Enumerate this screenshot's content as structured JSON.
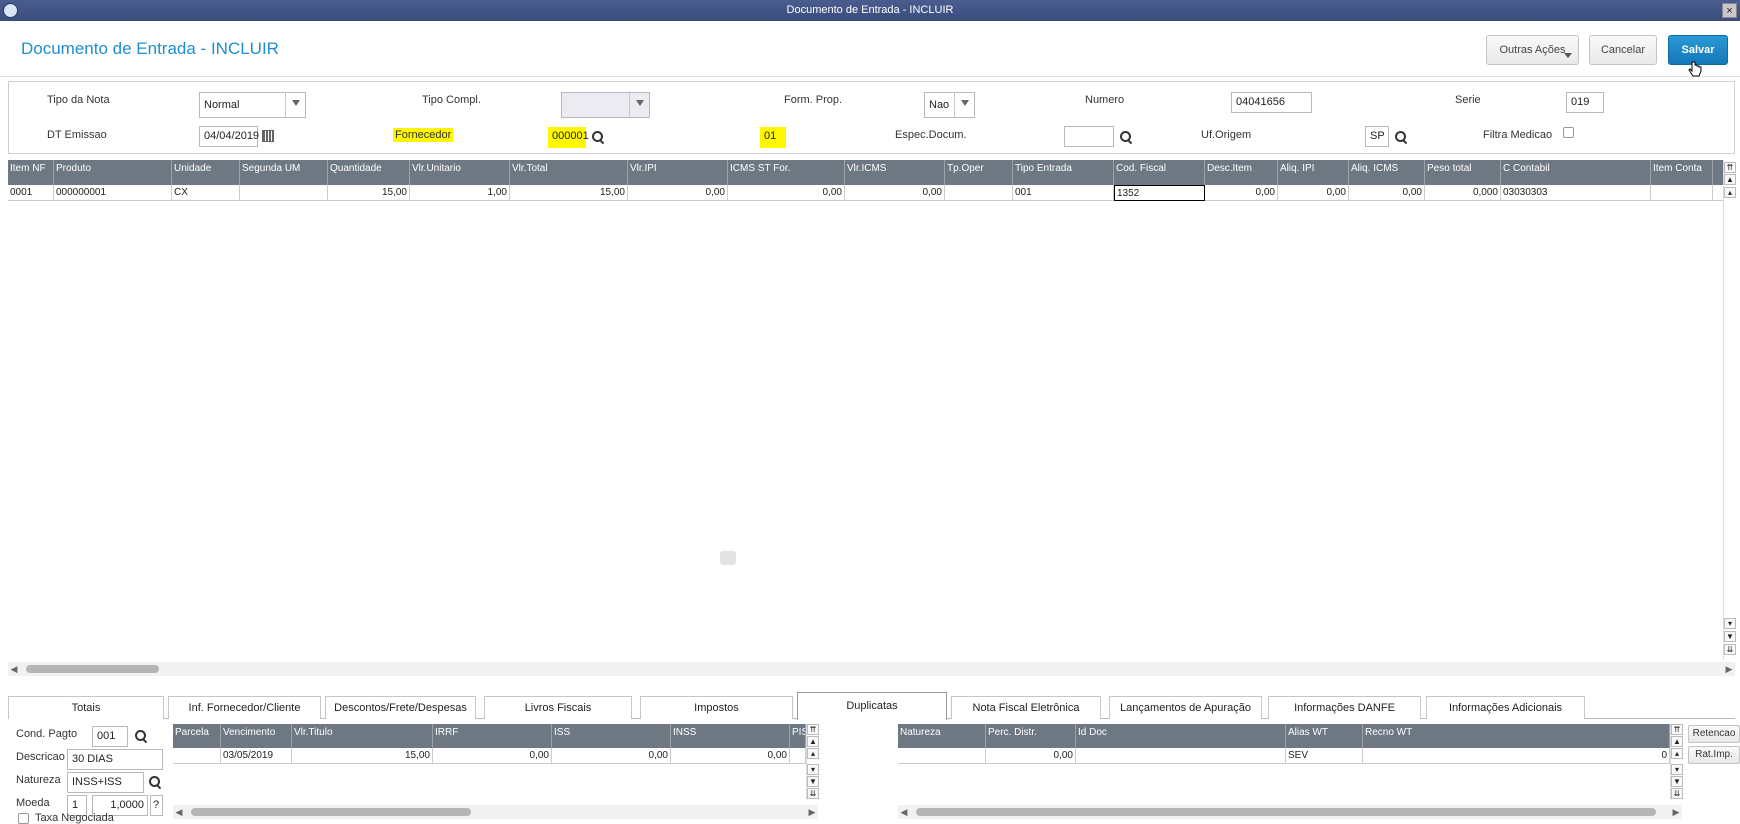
{
  "window": {
    "title": "Documento de Entrada - INCLUIR"
  },
  "header": {
    "title": "Documento de Entrada - INCLUIR",
    "other_actions": "Outras Ações",
    "cancel": "Cancelar",
    "save": "Salvar"
  },
  "form": {
    "tipo_nota": {
      "label": "Tipo da Nota",
      "value": "Normal"
    },
    "tipo_compl": {
      "label": "Tipo Compl.",
      "value": ""
    },
    "form_prop": {
      "label": "Form. Prop.",
      "value": "Nao"
    },
    "numero": {
      "label": "Numero",
      "value": "04041656"
    },
    "serie": {
      "label": "Serie",
      "value": "019"
    },
    "dt_emissao": {
      "label": "DT Emissao",
      "value": "04/04/2019"
    },
    "fornecedor": {
      "label": "Fornecedor",
      "value": "000001",
      "loja": "01"
    },
    "espec_docum": {
      "label": "Espec.Docum.",
      "value": ""
    },
    "uf_origem": {
      "label": "Uf.Origem",
      "value": "SP"
    },
    "filtra_medicao": {
      "label": "Filtra Medicao",
      "checked": false
    }
  },
  "items_grid": {
    "columns": [
      "Item NF",
      "Produto",
      "Unidade",
      "Segunda UM",
      "Quantidade",
      "Vlr.Unitario",
      "Vlr.Total",
      "Vlr.IPI",
      "ICMS ST For.",
      "Vlr.ICMS",
      "Tp.Oper",
      "Tipo Entrada",
      "Cod. Fiscal",
      "Desc.Item",
      "Aliq. IPI",
      "Aliq. ICMS",
      "Peso total",
      "C Contabil",
      "Item Conta"
    ],
    "rows": [
      [
        "0001",
        "000000001",
        "CX",
        "",
        "15,00",
        "1,00",
        "15,00",
        "0,00",
        "0,00",
        "0,00",
        "",
        "001",
        "1352",
        "0,00",
        "0,00",
        "0,00",
        "0,000",
        "03030303",
        ""
      ]
    ]
  },
  "tabs": [
    {
      "label": "Totais",
      "active": false
    },
    {
      "label": "Inf. Fornecedor/Cliente",
      "active": false
    },
    {
      "label": "Descontos/Frete/Despesas",
      "active": false
    },
    {
      "label": "Livros Fiscais",
      "active": false
    },
    {
      "label": "Impostos",
      "active": false
    },
    {
      "label": "Duplicatas",
      "active": true
    },
    {
      "label": "Nota Fiscal Eletrônica",
      "active": false
    },
    {
      "label": "Lançamentos de Apuração",
      "active": false
    },
    {
      "label": "Informações DANFE",
      "active": false
    },
    {
      "label": "Informações Adicionais",
      "active": false
    }
  ],
  "duplicatas": {
    "cond_pagto": {
      "label": "Cond. Pagto",
      "value": "001"
    },
    "descricao": {
      "label": "Descricao",
      "value": "30 DIAS"
    },
    "natureza": {
      "label": "Natureza",
      "value": "INSS+ISS"
    },
    "moeda": {
      "label": "Moeda",
      "value": "1",
      "rate": "1,0000",
      "help": "?"
    },
    "taxa_negociada": {
      "label": "Taxa Negociada",
      "checked": false
    },
    "parcelas_columns": [
      "Parcela",
      "Vencimento",
      "Vlr.Titulo",
      "IRRF",
      "ISS",
      "INSS",
      "PIS/PASEP"
    ],
    "parcelas_rows": [
      [
        "",
        "03/05/2019",
        "15,00",
        "0,00",
        "0,00",
        "0,00",
        ""
      ]
    ],
    "natureza_columns": [
      "Natureza",
      "Perc. Distr.",
      "Id Doc",
      "Alias WT",
      "Recno WT"
    ],
    "natureza_rows": [
      [
        "",
        "0,00",
        "",
        "SEV",
        "0"
      ]
    ],
    "retencao": "Retencao",
    "rat_imp": "Rat.Imp."
  }
}
